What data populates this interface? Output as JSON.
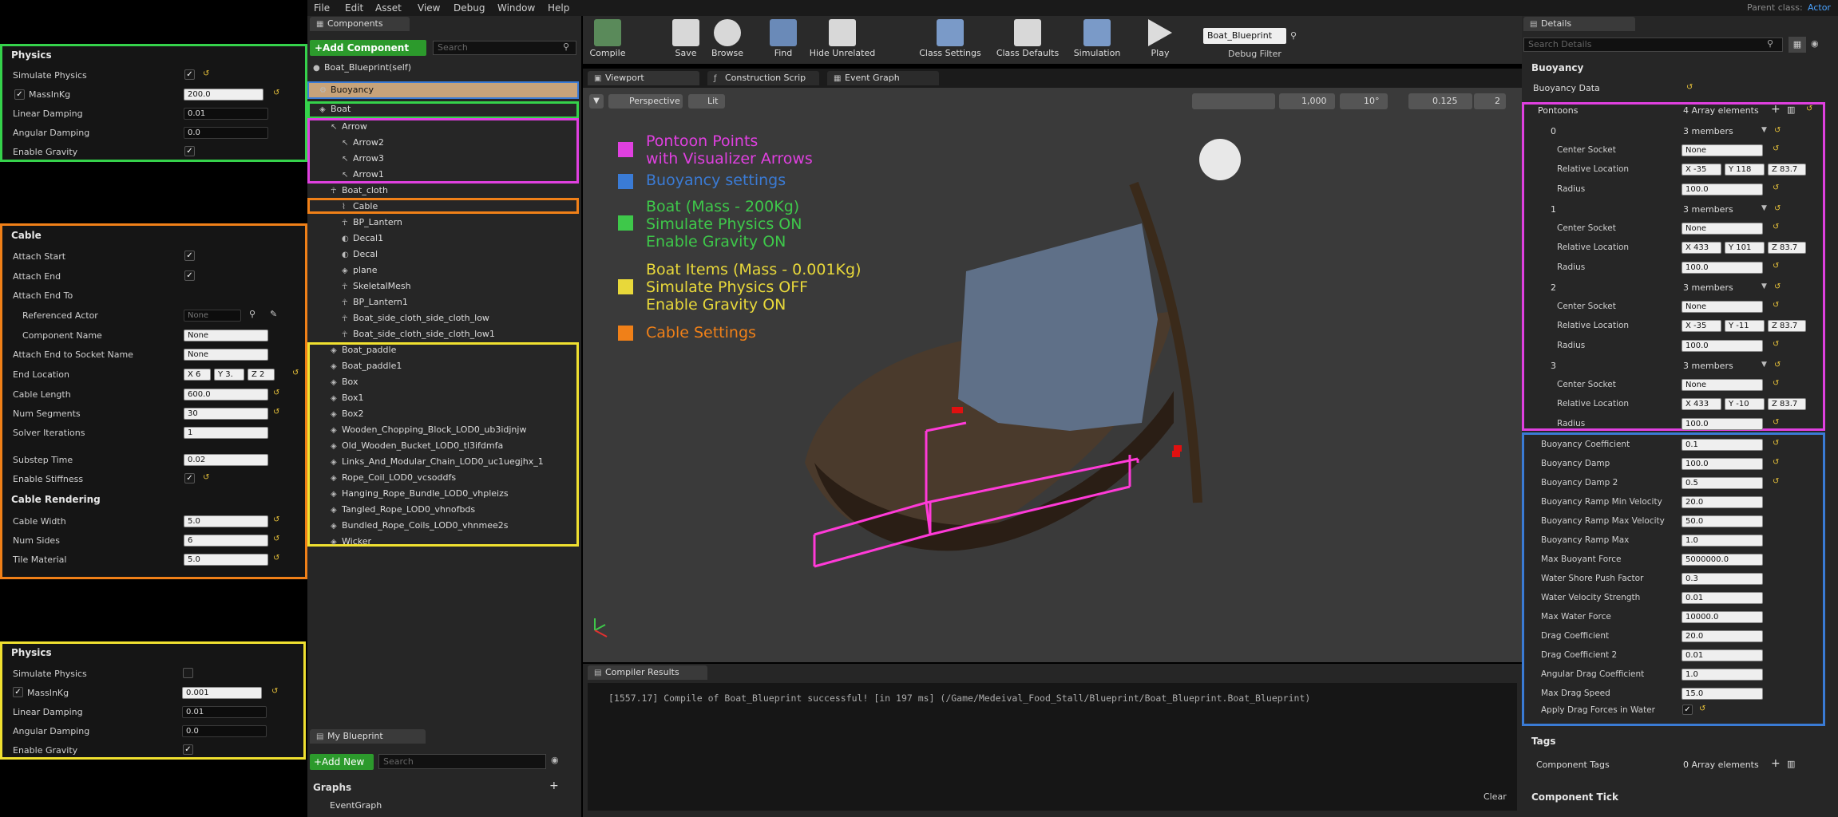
{
  "menu": {
    "items": [
      "File",
      "Edit",
      "Asset",
      "View",
      "Debug",
      "Window",
      "Help"
    ],
    "parent_class_label": "Parent class:",
    "parent_class_value": "Actor"
  },
  "left_physics": {
    "title": "Physics",
    "rows": [
      {
        "label": "Simulate Physics",
        "type": "check",
        "checked": true
      },
      {
        "label": "MassInKg",
        "type": "value",
        "value": "200.0",
        "checked": true
      },
      {
        "label": "Linear Damping",
        "type": "value",
        "value": "0.01"
      },
      {
        "label": "Angular Damping",
        "type": "value",
        "value": "0.0"
      },
      {
        "label": "Enable Gravity",
        "type": "check",
        "checked": true
      }
    ]
  },
  "cable": {
    "title": "Cable",
    "attach_start": "Attach Start",
    "attach_end": "Attach End",
    "attach_end_to": "Attach End To",
    "referenced_actor": "Referenced Actor",
    "referenced_actor_value": "None",
    "component_name": "Component Name",
    "component_name_value": "None",
    "attach_socket": "Attach End to Socket Name",
    "attach_socket_value": "None",
    "end_location": "End Location",
    "end_x": "X 6",
    "end_y": "Y 3.",
    "end_z": "Z 2",
    "cable_length": "Cable Length",
    "cable_length_value": "600.0",
    "num_segments": "Num Segments",
    "num_segments_value": "30",
    "solver_iterations": "Solver Iterations",
    "solver_iterations_value": "1",
    "substep_time": "Substep Time",
    "substep_time_value": "0.02",
    "enable_stiffness": "Enable Stiffness",
    "rendering_title": "Cable Rendering",
    "cable_width": "Cable Width",
    "cable_width_value": "5.0",
    "num_sides": "Num Sides",
    "num_sides_value": "6",
    "tile_material": "Tile Material",
    "tile_material_value": "5.0"
  },
  "items_physics": {
    "title": "Physics",
    "rows": [
      {
        "label": "Simulate Physics",
        "type": "check",
        "checked": false
      },
      {
        "label": "MassInKg",
        "type": "value",
        "value": "0.001",
        "checked": true
      },
      {
        "label": "Linear Damping",
        "type": "value",
        "value": "0.01"
      },
      {
        "label": "Angular Damping",
        "type": "value",
        "value": "0.0"
      },
      {
        "label": "Enable Gravity",
        "type": "check",
        "checked": true
      }
    ]
  },
  "components": {
    "tab": "Components",
    "add_button": "+Add Component",
    "search_placeholder": "Search",
    "root": "Boat_Blueprint(self)",
    "tree": [
      {
        "label": "Buoyancy",
        "depth": 0,
        "icon": "gear-icon"
      },
      {
        "label": "Boat",
        "depth": 0,
        "icon": "mesh-icon"
      },
      {
        "label": "Arrow",
        "depth": 1,
        "icon": "arrow-icon"
      },
      {
        "label": "Arrow2",
        "depth": 2,
        "icon": "arrow-icon"
      },
      {
        "label": "Arrow3",
        "depth": 2,
        "icon": "arrow-icon"
      },
      {
        "label": "Arrow1",
        "depth": 2,
        "icon": "arrow-icon"
      },
      {
        "label": "Boat_cloth",
        "depth": 1,
        "icon": "skeleton-icon"
      },
      {
        "label": "Cable",
        "depth": 2,
        "icon": "cable-icon"
      },
      {
        "label": "BP_Lantern",
        "depth": 2,
        "icon": "skeleton-icon"
      },
      {
        "label": "Decal1",
        "depth": 2,
        "icon": "decal-icon"
      },
      {
        "label": "Decal",
        "depth": 2,
        "icon": "decal-icon"
      },
      {
        "label": "plane",
        "depth": 2,
        "icon": "mesh-icon"
      },
      {
        "label": "SkeletalMesh",
        "depth": 2,
        "icon": "skeleton-icon"
      },
      {
        "label": "BP_Lantern1",
        "depth": 2,
        "icon": "skeleton-icon"
      },
      {
        "label": "Boat_side_cloth_side_cloth_low",
        "depth": 2,
        "icon": "skeleton-icon"
      },
      {
        "label": "Boat_side_cloth_side_cloth_low1",
        "depth": 2,
        "icon": "skeleton-icon"
      },
      {
        "label": "Boat_paddle",
        "depth": 1,
        "icon": "mesh-icon"
      },
      {
        "label": "Boat_paddle1",
        "depth": 1,
        "icon": "mesh-icon"
      },
      {
        "label": "Box",
        "depth": 1,
        "icon": "mesh-icon"
      },
      {
        "label": "Box1",
        "depth": 1,
        "icon": "mesh-icon"
      },
      {
        "label": "Box2",
        "depth": 1,
        "icon": "mesh-icon"
      },
      {
        "label": "Wooden_Chopping_Block_LOD0_ub3idjnjw",
        "depth": 1,
        "icon": "mesh-icon"
      },
      {
        "label": "Old_Wooden_Bucket_LOD0_tl3ifdmfa",
        "depth": 1,
        "icon": "mesh-icon"
      },
      {
        "label": "Links_And_Modular_Chain_LOD0_uc1uegjhx_1",
        "depth": 1,
        "icon": "mesh-icon"
      },
      {
        "label": "Rope_Coil_LOD0_vcsoddfs",
        "depth": 1,
        "icon": "mesh-icon"
      },
      {
        "label": "Hanging_Rope_Bundle_LOD0_vhpleizs",
        "depth": 1,
        "icon": "mesh-icon"
      },
      {
        "label": "Tangled_Rope_LOD0_vhnofbds",
        "depth": 1,
        "icon": "mesh-icon"
      },
      {
        "label": "Bundled_Rope_Coils_LOD0_vhnmee2s",
        "depth": 1,
        "icon": "mesh-icon"
      },
      {
        "label": "Wicker",
        "depth": 1,
        "icon": "mesh-icon"
      }
    ]
  },
  "my_blueprint": {
    "tab": "My Blueprint",
    "add_new": "+Add New",
    "search_placeholder": "Search",
    "graphs": "Graphs",
    "event_graph": "EventGraph"
  },
  "toolbar": {
    "buttons": [
      "Compile",
      "Save",
      "Browse",
      "Find",
      "Hide Unrelated",
      "Class Settings",
      "Class Defaults",
      "Simulation",
      "Play"
    ],
    "debug_select": "Boat_Blueprint",
    "debug_filter": "Debug Filter"
  },
  "editor_tabs": [
    "Viewport",
    "Construction Scrip",
    "Event Graph"
  ],
  "viewport": {
    "perspective": "Perspective",
    "lit": "Lit",
    "snap_move": "1,000",
    "snap_rot": "10°",
    "snap_scale": "0.125",
    "camera_speed": "2"
  },
  "legend": [
    {
      "text": "Pontoon Points\nwith Visualizer Arrows",
      "color": "#e040e0"
    },
    {
      "text": "Buoyancy settings",
      "color": "#3a7bd5"
    },
    {
      "text": "Boat (Mass - 200Kg)\nSimulate Physics ON\nEnable Gravity ON",
      "color": "#3ec84a"
    },
    {
      "text": "Boat Items (Mass - 0.001Kg)\nSimulate Physics OFF\nEnable Gravity ON",
      "color": "#e8d83a"
    },
    {
      "text": "Cable Settings",
      "color": "#f08018"
    }
  ],
  "compiler": {
    "tab": "Compiler Results",
    "message": "[1557.17] Compile of Boat_Blueprint successful! [in 197 ms] (/Game/Medeival_Food_Stall/Blueprint/Boat_Blueprint.Boat_Blueprint)",
    "clear": "Clear"
  },
  "details": {
    "tab": "Details",
    "search_placeholder": "Search Details",
    "buoyancy_title": "Buoyancy",
    "buoyancy_data": "Buoyancy Data",
    "pontoons": "Pontoons",
    "pontoons_value": "4 Array elements",
    "pontoon_items": [
      {
        "index": "0",
        "members": "3 members",
        "socket": "None",
        "x": "X -35",
        "y": "Y 118",
        "z": "Z 83.7",
        "radius": "100.0"
      },
      {
        "index": "1",
        "members": "3 members",
        "socket": "None",
        "x": "X 433",
        "y": "Y 101",
        "z": "Z 83.7",
        "radius": "100.0"
      },
      {
        "index": "2",
        "members": "3 members",
        "socket": "None",
        "x": "X -35",
        "y": "Y -11",
        "z": "Z 83.7",
        "radius": "100.0"
      },
      {
        "index": "3",
        "members": "3 members",
        "socket": "None",
        "x": "X 433",
        "y": "Y -10",
        "z": "Z 83.7",
        "radius": "100.0"
      }
    ],
    "center_socket": "Center Socket",
    "relative_location": "Relative Location",
    "radius": "Radius",
    "settings": [
      {
        "label": "Buoyancy Coefficient",
        "value": "0.1"
      },
      {
        "label": "Buoyancy Damp",
        "value": "100.0"
      },
      {
        "label": "Buoyancy Damp 2",
        "value": "0.5"
      },
      {
        "label": "Buoyancy Ramp Min Velocity",
        "value": "20.0"
      },
      {
        "label": "Buoyancy Ramp Max Velocity",
        "value": "50.0"
      },
      {
        "label": "Buoyancy Ramp Max",
        "value": "1.0"
      },
      {
        "label": "Max Buoyant Force",
        "value": "5000000.0"
      },
      {
        "label": "Water Shore Push Factor",
        "value": "0.3"
      },
      {
        "label": "Water Velocity Strength",
        "value": "0.01"
      },
      {
        "label": "Max Water Force",
        "value": "10000.0"
      },
      {
        "label": "Drag Coefficient",
        "value": "20.0"
      },
      {
        "label": "Drag Coefficient 2",
        "value": "0.01"
      },
      {
        "label": "Angular Drag Coefficient",
        "value": "1.0"
      },
      {
        "label": "Max Drag Speed",
        "value": "15.0"
      }
    ],
    "apply_drag": "Apply Drag Forces in Water",
    "tags_title": "Tags",
    "component_tags": "Component Tags",
    "component_tags_value": "0 Array elements",
    "component_tick": "Component Tick"
  }
}
